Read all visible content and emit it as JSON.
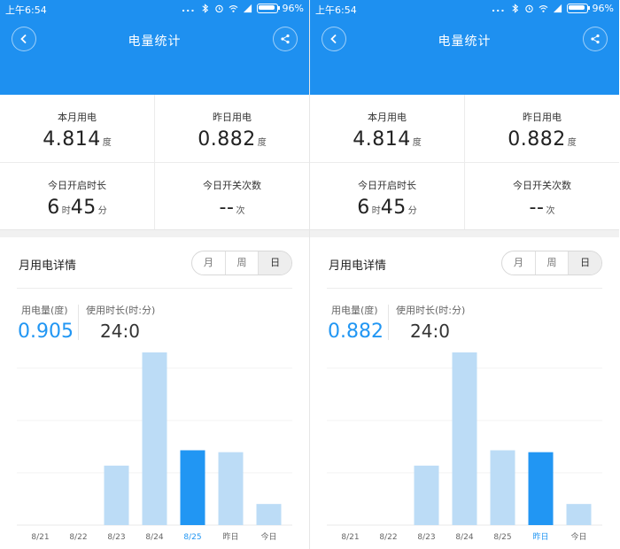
{
  "panels": [
    {
      "status": {
        "time": "上午6:54",
        "dots": "...",
        "battery_pct": "96%"
      },
      "nav": {
        "title": "电量统计"
      },
      "stats": {
        "month": {
          "label": "本月用电",
          "value": "4.814",
          "unit": "度"
        },
        "yesterday": {
          "label": "昨日用电",
          "value": "0.882",
          "unit": "度"
        },
        "today_duration": {
          "label": "今日开启时长",
          "hours": "6",
          "hours_unit": "时",
          "minutes": "45",
          "minutes_unit": "分"
        },
        "today_switches": {
          "label": "今日开关次数",
          "value": "--",
          "unit": "次"
        }
      },
      "detail": {
        "title": "月用电详情",
        "tabs": [
          "月",
          "周",
          "日"
        ],
        "active_tab": "日",
        "usage_label": "用电量(度)",
        "usage_value": "0.905",
        "duration_label": "使用时长(时:分)",
        "duration_value": "24:0"
      },
      "chart_data": {
        "type": "bar",
        "categories": [
          "8/21",
          "8/22",
          "8/23",
          "8/24",
          "8/25",
          "昨日",
          "今日"
        ],
        "values": [
          0,
          0,
          0.62,
          1.8,
          0.78,
          0.76,
          0.22
        ],
        "ylim": [
          0,
          1.8
        ],
        "selected_index": 4,
        "colors": {
          "bar": "#bcdcf6",
          "selected": "#2196f3",
          "selected_label": "#2196f3",
          "label": "#666666"
        }
      }
    },
    {
      "status": {
        "time": "上午6:54",
        "dots": "...",
        "battery_pct": "96%"
      },
      "nav": {
        "title": "电量统计"
      },
      "stats": {
        "month": {
          "label": "本月用电",
          "value": "4.814",
          "unit": "度"
        },
        "yesterday": {
          "label": "昨日用电",
          "value": "0.882",
          "unit": "度"
        },
        "today_duration": {
          "label": "今日开启时长",
          "hours": "6",
          "hours_unit": "时",
          "minutes": "45",
          "minutes_unit": "分"
        },
        "today_switches": {
          "label": "今日开关次数",
          "value": "--",
          "unit": "次"
        }
      },
      "detail": {
        "title": "月用电详情",
        "tabs": [
          "月",
          "周",
          "日"
        ],
        "active_tab": "日",
        "usage_label": "用电量(度)",
        "usage_value": "0.882",
        "duration_label": "使用时长(时:分)",
        "duration_value": "24:0"
      },
      "chart_data": {
        "type": "bar",
        "categories": [
          "8/21",
          "8/22",
          "8/23",
          "8/24",
          "8/25",
          "昨日",
          "今日"
        ],
        "values": [
          0,
          0,
          0.62,
          1.8,
          0.78,
          0.76,
          0.22
        ],
        "ylim": [
          0,
          1.8
        ],
        "selected_index": 5,
        "colors": {
          "bar": "#bcdcf6",
          "selected": "#2196f3",
          "selected_label": "#2196f3",
          "label": "#666666"
        }
      }
    }
  ],
  "theme": {
    "header_bg": "#1e90f0",
    "accent": "#2196f3"
  }
}
